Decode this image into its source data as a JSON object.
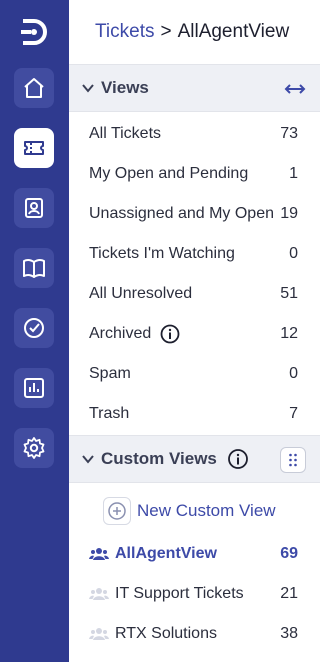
{
  "rail": {
    "items": [
      {
        "name": "home"
      },
      {
        "name": "tickets",
        "active": true
      },
      {
        "name": "contacts"
      },
      {
        "name": "knowledge-base"
      },
      {
        "name": "tasks"
      },
      {
        "name": "reports"
      },
      {
        "name": "settings"
      }
    ]
  },
  "header": {
    "crumb_link": "Tickets",
    "separator": ">",
    "current": "AllAgentView"
  },
  "views": {
    "title": "Views",
    "items": [
      {
        "label": "All Tickets",
        "count": "73"
      },
      {
        "label": "My Open and Pending",
        "count": "1"
      },
      {
        "label": "Unassigned and My Open",
        "count": "19"
      },
      {
        "label": "Tickets I'm Watching",
        "count": "0"
      },
      {
        "label": "All Unresolved",
        "count": "51"
      },
      {
        "label": "Archived",
        "count": "12"
      },
      {
        "label": "Spam",
        "count": "0"
      },
      {
        "label": "Trash",
        "count": "7"
      }
    ]
  },
  "custom_views": {
    "title": "Custom Views",
    "new_label": "New Custom View",
    "items": [
      {
        "label": "AllAgentView",
        "count": "69",
        "active": true
      },
      {
        "label": "IT Support Tickets",
        "count": "21"
      },
      {
        "label": "RTX Solutions",
        "count": "38"
      }
    ]
  },
  "colors": {
    "rail": "#2f3a8f",
    "accent": "#3d4aa8",
    "section_bg": "#eef0f5"
  }
}
